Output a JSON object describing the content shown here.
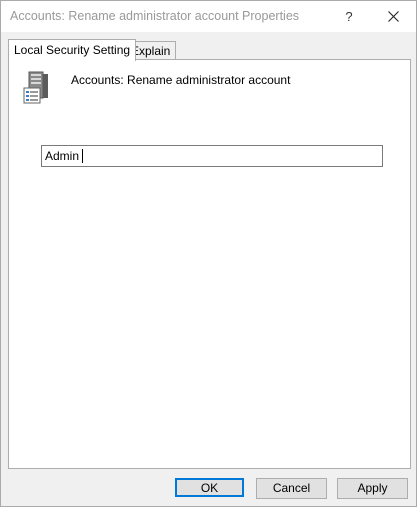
{
  "window": {
    "title": "Accounts: Rename administrator account Properties",
    "help_label": "?"
  },
  "tabs": [
    {
      "label": "Local Security Setting",
      "active": true
    },
    {
      "label": "Explain",
      "active": false
    }
  ],
  "panel": {
    "policy_name": "Accounts: Rename administrator account",
    "icon": "server-policy-icon",
    "input_value": "Admin"
  },
  "buttons": {
    "ok": "OK",
    "cancel": "Cancel",
    "apply": "Apply"
  },
  "colors": {
    "accent": "#0078d7",
    "title_text": "#999999"
  }
}
